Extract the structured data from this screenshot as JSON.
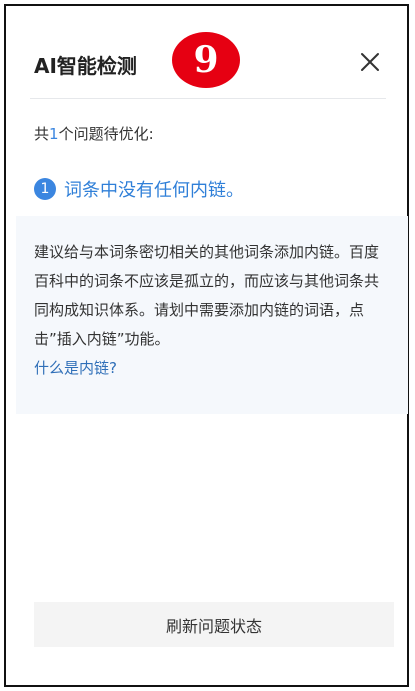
{
  "header": {
    "title": "AI智能检测",
    "badge_number": "9",
    "close_icon": "close-icon"
  },
  "summary": {
    "prefix": "共",
    "count": "1",
    "suffix": "个问题待优化:"
  },
  "issue": {
    "number": "1",
    "text": "词条中没有任何内链。"
  },
  "advice": {
    "text": "建议给与本词条密切相关的其他词条添加内链。百度百科中的词条不应该是孤立的，而应该与其他词条共同构成知识体系。请划中需要添加内链的词语，点击”插入内链”功能。",
    "link_label": "什么是内链?"
  },
  "footer": {
    "refresh_label": "刷新问题状态"
  },
  "colors": {
    "accent": "#3b86e0",
    "badge": "#e60012",
    "advice_bg": "#f5f8fc"
  }
}
